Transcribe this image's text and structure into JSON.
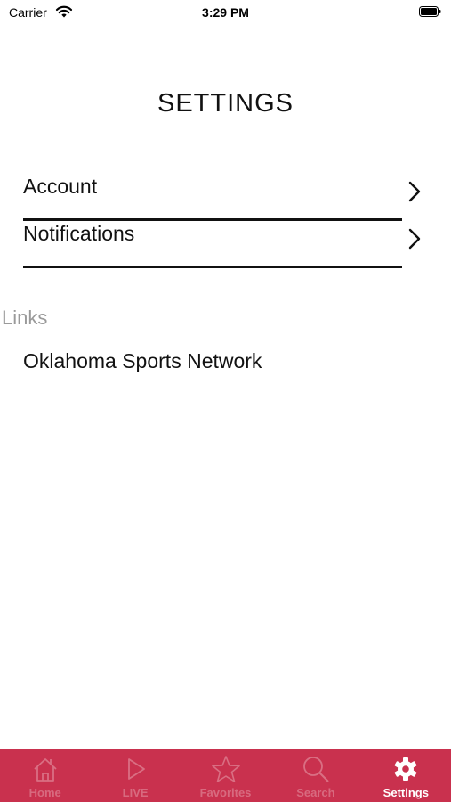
{
  "status_bar": {
    "carrier": "Carrier",
    "time": "3:29 PM"
  },
  "page": {
    "title": "SETTINGS"
  },
  "settings_rows": [
    {
      "label": "Account"
    },
    {
      "label": "Notifications"
    }
  ],
  "links": {
    "header": "Links",
    "items": [
      {
        "label": "Oklahoma Sports Network"
      }
    ]
  },
  "tab_bar": {
    "background": "#c9314e",
    "tabs": [
      {
        "label": "Home",
        "icon": "home-icon",
        "active": false
      },
      {
        "label": "LIVE",
        "icon": "play-icon",
        "active": false
      },
      {
        "label": "Favorites",
        "icon": "star-icon",
        "active": false
      },
      {
        "label": "Search",
        "icon": "search-icon",
        "active": false
      },
      {
        "label": "Settings",
        "icon": "gear-icon",
        "active": true
      }
    ]
  }
}
